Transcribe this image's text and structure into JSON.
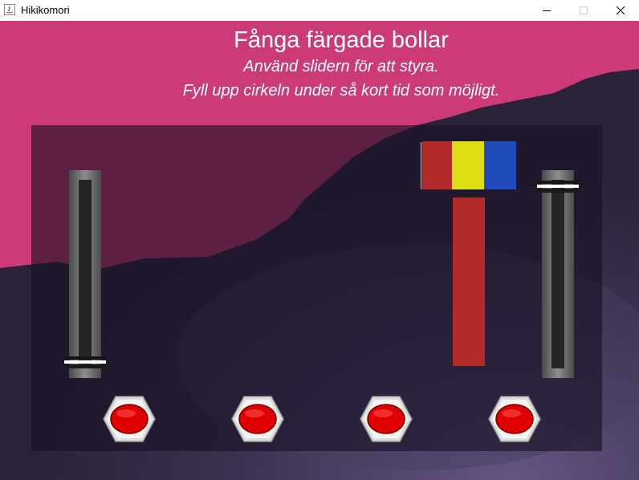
{
  "window": {
    "title": "Hikikomori"
  },
  "game": {
    "heading": "Fånga färgade bollar",
    "instruction1": "Använd slidern för att styra.",
    "instruction2": "Fyll upp cirkeln under så kort tid som möjligt.",
    "left_slider_level": 0.0,
    "right_slider_level": 1.0,
    "target_colors": [
      "#b22a2a",
      "#dede14",
      "#1f4ab8"
    ],
    "fill_color": "#b22a2a",
    "button_color": "#e00000",
    "button_count": 4
  },
  "colors": {
    "sky": "#cc3a77",
    "ground": "#2c2438",
    "panel": "#1c1726"
  }
}
